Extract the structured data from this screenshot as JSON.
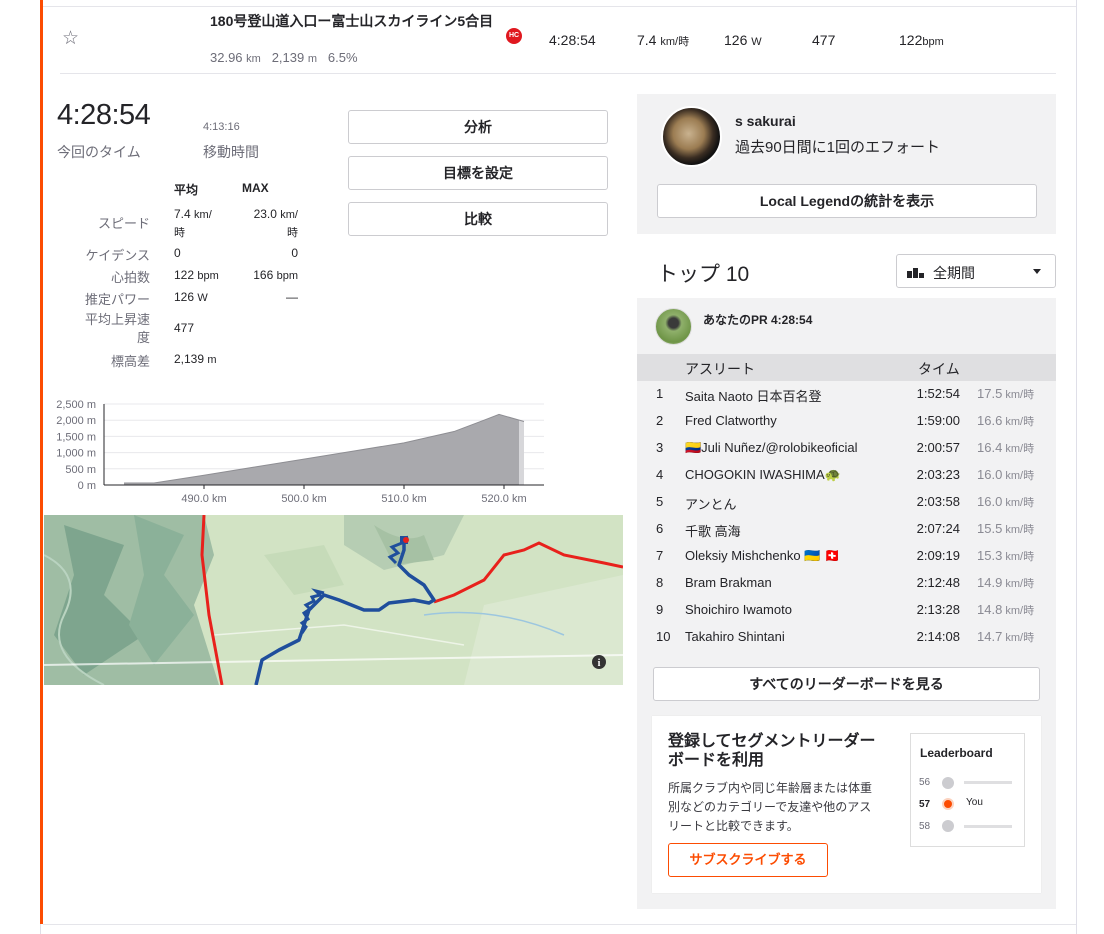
{
  "segment": {
    "name": "180号登山道入口ー富士山スカイライン5合目",
    "distance": "32.96",
    "distance_unit": "km",
    "elevation": "2,139",
    "elevation_unit": "m",
    "grade": "6.5%",
    "category_badge": "HC",
    "time": "4:28:54",
    "speed": "7.4",
    "speed_unit": "km/時",
    "power": "126",
    "power_unit": "W",
    "vam": "477",
    "heartrate": "122",
    "heartrate_unit": "bpm"
  },
  "effort": {
    "elapsed_time": "4:28:54",
    "elapsed_label": "今回のタイム",
    "moving_time": "4:13:16",
    "moving_label": "移動時間"
  },
  "stats": {
    "col_avg": "平均",
    "col_max": "MAX",
    "rows": [
      {
        "label": "スピード",
        "avg": "7.4",
        "avg_unit": "km/",
        "avg_unit2": "時",
        "max": "23.0",
        "max_unit": "km/",
        "max_unit2": "時"
      },
      {
        "label": "ケイデンス",
        "avg": "0",
        "max": "0"
      },
      {
        "label": "心拍数",
        "avg": "122",
        "avg_unit": "bpm",
        "max": "166",
        "max_unit": "bpm"
      },
      {
        "label": "推定パワー",
        "avg": "126",
        "avg_unit": "W",
        "max": "—"
      },
      {
        "label": "平均上昇速",
        "label2": "度",
        "avg": "477"
      },
      {
        "label": "標高差",
        "avg": "2,139",
        "avg_unit": "m"
      }
    ]
  },
  "actions": {
    "analyze": "分析",
    "set_goal": "目標を設定",
    "compare": "比較"
  },
  "chart_data": {
    "type": "area",
    "x": [
      482,
      485,
      490,
      495,
      500,
      505,
      510,
      515,
      518,
      519.5,
      522
    ],
    "y": [
      60,
      60,
      300,
      550,
      800,
      1050,
      1300,
      1650,
      2000,
      2180,
      1960
    ],
    "highlight_range": [
      482,
      521.5
    ],
    "xticks": [
      "490.0 km",
      "500.0 km",
      "510.0 km",
      "520.0 km"
    ],
    "xtick_values": [
      490,
      500,
      510,
      520
    ],
    "yticks": [
      "2,500 m",
      "2,000 m",
      "1,500 m",
      "1,000 m",
      "500 m",
      "0 m"
    ],
    "ytick_values": [
      2500,
      2000,
      1500,
      1000,
      500,
      0
    ],
    "xlim": [
      480,
      524
    ],
    "ylim": [
      0,
      2500
    ]
  },
  "map": {
    "info_icon": "info-icon"
  },
  "local_legend": {
    "name": "s sakurai",
    "subtitle": "過去90日間に1回のエフォート",
    "button": "Local Legendの統計を表示"
  },
  "leaderboard": {
    "title": "トップ 10",
    "period": "全期間",
    "pr_label": "あなたのPR 4:28:54",
    "col_athlete": "アスリート",
    "col_time": "タイム",
    "speed_unit": "km/時",
    "rows": [
      {
        "rank": "1",
        "name": "Saita Naoto 日本百名登",
        "time": "1:52:54",
        "speed": "17.5"
      },
      {
        "rank": "2",
        "name": "Fred Clatworthy",
        "time": "1:59:00",
        "speed": "16.6"
      },
      {
        "rank": "3",
        "name": "🇨🇴Juli Nuñez/@rolobikeoficial",
        "time": "2:00:57",
        "speed": "16.4"
      },
      {
        "rank": "4",
        "name": "CHOGOKIN IWASHIMA🐢",
        "time": "2:03:23",
        "speed": "16.0"
      },
      {
        "rank": "5",
        "name": "アンとん",
        "time": "2:03:58",
        "speed": "16.0"
      },
      {
        "rank": "6",
        "name": "千歌 高海",
        "time": "2:07:24",
        "speed": "15.5"
      },
      {
        "rank": "7",
        "name": "Oleksiy Mishchenko 🇺🇦 🇨🇭",
        "time": "2:09:19",
        "speed": "15.3"
      },
      {
        "rank": "8",
        "name": "Bram Brakman",
        "time": "2:12:48",
        "speed": "14.9"
      },
      {
        "rank": "9",
        "name": "Shoichiro Iwamoto",
        "time": "2:13:28",
        "speed": "14.8"
      },
      {
        "rank": "10",
        "name": "Takahiro Shintani",
        "time": "2:14:08",
        "speed": "14.7"
      }
    ],
    "view_all": "すべてのリーダーボードを見る"
  },
  "promo": {
    "title": "登録してセグメントリーダーボードを利用",
    "body": "所属クラブ内や同じ年齢層または体重別などのカテゴリーで友達や他のアスリートと比較できます。",
    "button": "サブスクライブする",
    "card_title": "Leaderboard",
    "card_rows": [
      {
        "rank": "56",
        "label": ""
      },
      {
        "rank": "57",
        "label": "You"
      },
      {
        "rank": "58",
        "label": ""
      }
    ]
  },
  "colors": {
    "accent": "#fc4c02",
    "hc_badge": "#e0181f",
    "route_blue": "#1f4e9c",
    "route_red": "#e8211c"
  }
}
